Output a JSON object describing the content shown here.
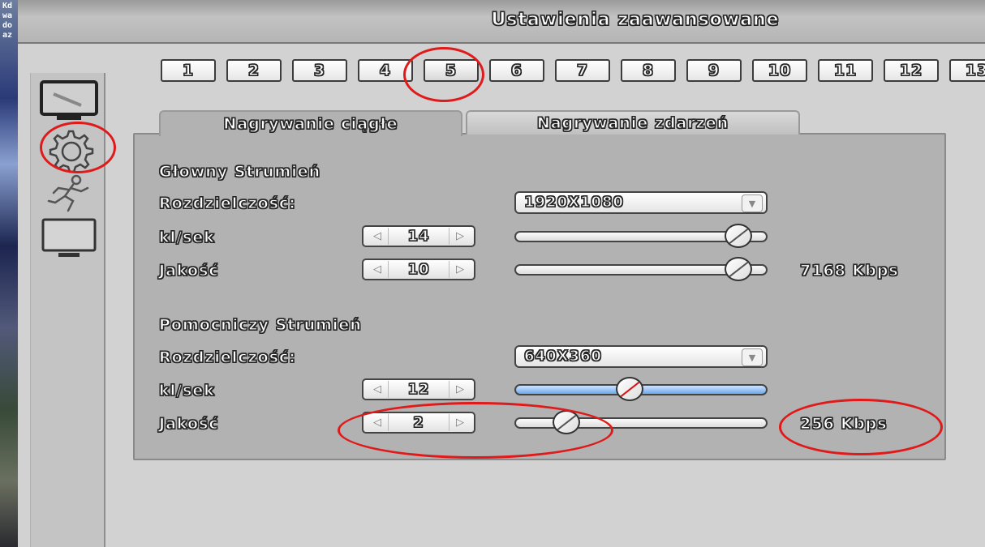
{
  "window": {
    "title": "Ustawienia zaawansowane"
  },
  "left_strip": {
    "text": "Kdwadoaz"
  },
  "side_icons": [
    "monitor-icon",
    "gear-icon",
    "running-person-icon",
    "display-icon"
  ],
  "channel_tabs": {
    "items": [
      "1",
      "2",
      "3",
      "4",
      "5",
      "6",
      "7",
      "8",
      "9",
      "10",
      "11",
      "12",
      "13"
    ],
    "selected": "5"
  },
  "mode_tabs": {
    "continuous": "Nagrywanie ciągłe",
    "event": "Nagrywanie zdarzeń",
    "selected": "continuous"
  },
  "main_stream": {
    "heading": "Głowny Strumień",
    "resolution_label": "Rozdzielczość:",
    "resolution_value": "1920X1080",
    "fps_label": "kl/sek",
    "fps_value": "14",
    "fps_slider_fraction": 0.93,
    "quality_label": "Jakość",
    "quality_value": "10",
    "quality_slider_fraction": 0.93,
    "bitrate": "7168 Kbps"
  },
  "sub_stream": {
    "heading": "Pomocniczy Strumień",
    "resolution_label": "Rozdzielczość:",
    "resolution_value": "640X360",
    "fps_label": "kl/sek",
    "fps_value": "12",
    "fps_slider_fraction": 0.45,
    "quality_label": "Jakość",
    "quality_value": "2",
    "quality_slider_fraction": 0.17,
    "bitrate": "256 Kbps"
  },
  "colors": {
    "annotation_red": "#e01a1a",
    "active_slider_blue": "#6ea8ec",
    "panel_gray": "#b2b2b2"
  }
}
